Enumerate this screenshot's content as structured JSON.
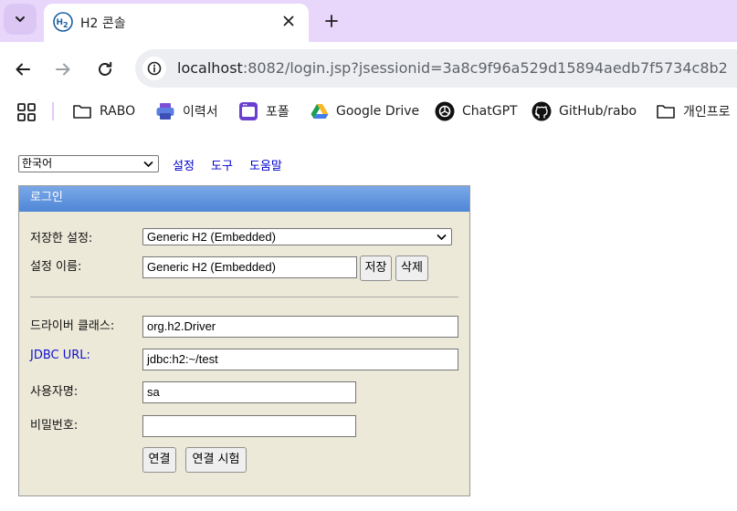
{
  "browser": {
    "tab_title": "H2 콘솔",
    "url_host": "localhost",
    "url_rest": ":8082/login.jsp?jsessionid=3a8c9f96a529d15894aedb7f5734c8b2"
  },
  "bookmarks": [
    {
      "label": "RABO",
      "icon": "folder-icon"
    },
    {
      "label": "이력서",
      "icon": "printer-icon"
    },
    {
      "label": "포폴",
      "icon": "app-window-icon"
    },
    {
      "label": "Google Drive",
      "icon": "google-drive-icon"
    },
    {
      "label": "ChatGPT",
      "icon": "chatgpt-icon"
    },
    {
      "label": "GitHub/rabo",
      "icon": "github-icon"
    },
    {
      "label": "개인프로",
      "icon": "folder-icon"
    }
  ],
  "toplinks": {
    "language": "한국어",
    "settings": "설정",
    "tools": "도구",
    "help": "도움말"
  },
  "login": {
    "header": "로그인",
    "saved_settings_label": "저장한 설정:",
    "saved_settings_value": "Generic H2 (Embedded)",
    "setting_name_label": "설정 이름:",
    "setting_name_value": "Generic H2 (Embedded)",
    "save_button": "저장",
    "delete_button": "삭제",
    "driver_class_label": "드라이버 클래스:",
    "driver_class_value": "org.h2.Driver",
    "jdbc_url_label": "JDBC URL:",
    "jdbc_url_value": "jdbc:h2:~/test",
    "username_label": "사용자명:",
    "username_value": "sa",
    "password_label": "비밀번호:",
    "password_value": "",
    "connect_button": "연결",
    "test_button": "연결 시험"
  },
  "colors": {
    "tabstrip": "#e9d7fb",
    "panel": "#ece9d8",
    "header_gradient_top": "#7aa8e8",
    "header_gradient_bottom": "#4f86d6",
    "link": "#0000cc"
  }
}
